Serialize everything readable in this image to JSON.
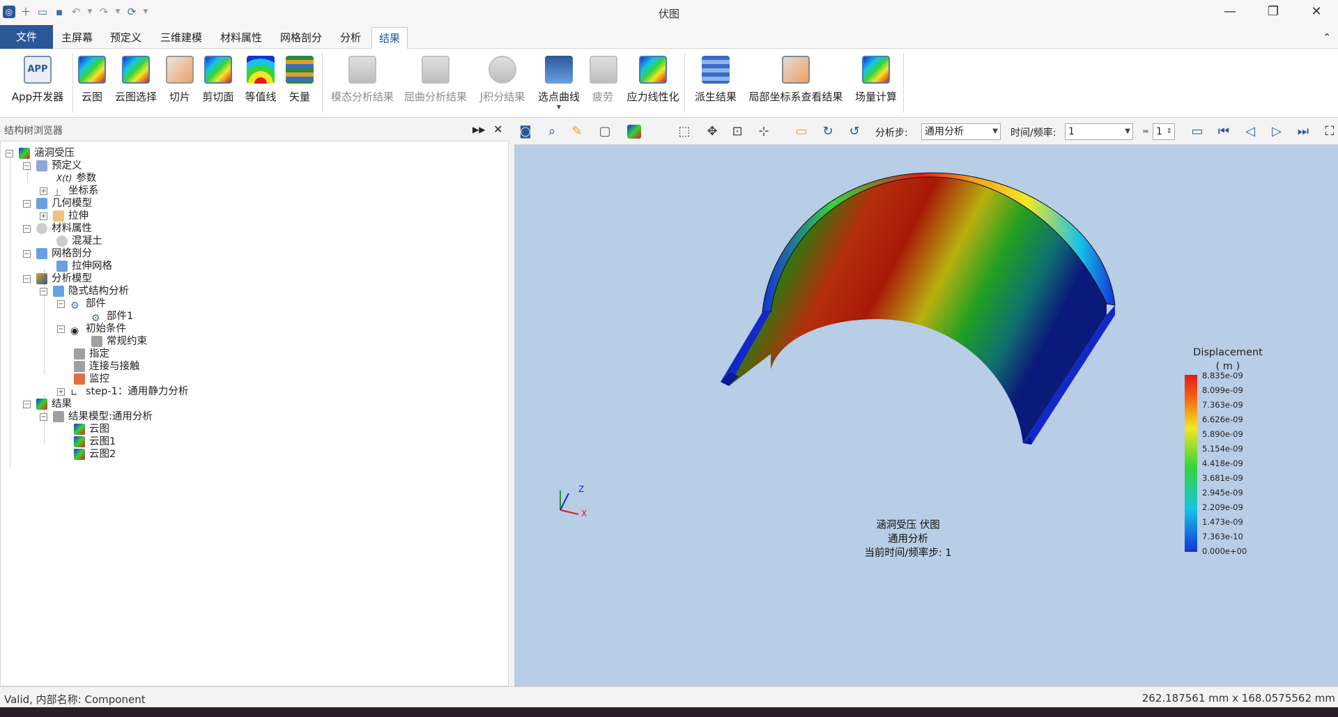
{
  "window": {
    "title": "伏图",
    "minimize": "—",
    "restore": "❐",
    "close": "✕"
  },
  "quick_access": [
    "app-logo-icon",
    "new-file-icon",
    "open-folder-icon",
    "save-icon",
    "undo-icon",
    "undo-dropdown-icon",
    "redo-icon",
    "redo-dropdown-icon",
    "refresh-icon",
    "customize-dropdown-icon"
  ],
  "tabs": {
    "file": "文件",
    "home": "主屏幕",
    "predef": "预定义",
    "model3d": "三维建模",
    "material": "材料属性",
    "mesh": "网格剖分",
    "analysis": "分析",
    "results": "结果",
    "collapse": "⌃"
  },
  "ribbon": {
    "app_dev": "App开发器",
    "app_icon_text": "APP",
    "contour": "云图",
    "contour_select": "云图选择",
    "slice": "切片",
    "cut_plane": "剪切面",
    "isoline": "等值线",
    "vector": "矢量",
    "modal": "模态分析结果",
    "buckling": "屈曲分析结果",
    "jintegral": "J积分结果",
    "probe_curve": "选点曲线",
    "fatigue": "疲劳",
    "linearize": "应力线性化",
    "derived": "派生结果",
    "local_cs": "局部坐标系查看结果",
    "field_calc": "场量计算"
  },
  "panel": {
    "title": "结构树浏览器",
    "pin": "▶▶",
    "close": "✕"
  },
  "tree": {
    "root": "涵洞受压",
    "predef": "预定义",
    "params": "参数",
    "params_prefix": "X(t)",
    "coord": "坐标系",
    "geometry": "几何模型",
    "extrude": "拉伸",
    "materials": "材料属性",
    "concrete": "混凝土",
    "meshing": "网格剖分",
    "extrude_mesh": "拉伸网格",
    "analysis_model": "分析模型",
    "implicit": "隐式结构分析",
    "parts": "部件",
    "part1": "部件1",
    "initial": "初始条件",
    "constraint": "常规约束",
    "assign": "指定",
    "contact": "连接与接触",
    "monitor": "监控",
    "step": "step-1：通用静力分析",
    "results": "结果",
    "result_model": "结果模型:通用分析",
    "contour": "云图",
    "contour1": "云图1",
    "contour2": "云图2"
  },
  "view_toolbar": {
    "step_label": "分析步:",
    "step_value": "通用分析",
    "time_label": "时间/频率:",
    "time_value": "1",
    "frame_value": "1"
  },
  "viewport": {
    "legend_title": "Displacement",
    "legend_unit": "( m )",
    "legend_values": [
      "8.835e-09",
      "8.099e-09",
      "7.363e-09",
      "6.626e-09",
      "5.890e-09",
      "5.154e-09",
      "4.418e-09",
      "3.681e-09",
      "2.945e-09",
      "2.209e-09",
      "1.473e-09",
      "7.363e-10",
      "0.000e+00"
    ],
    "caption_line1": "涵洞受压  伏图",
    "caption_line2": "通用分析",
    "caption_line3": "当前时间/频率步:  1",
    "axis_x": "X",
    "axis_z": "Z"
  },
  "status": {
    "left": "Valid, 内部名称: Component",
    "right": "262.187561 mm x 168.0575562 mm"
  }
}
